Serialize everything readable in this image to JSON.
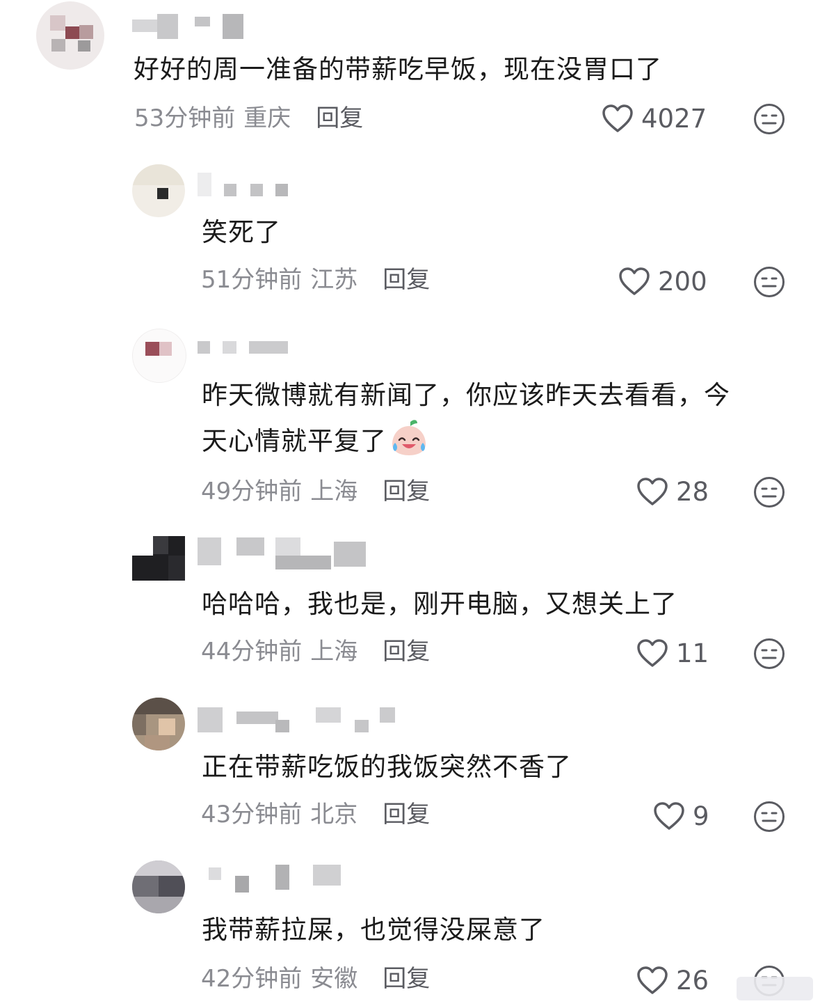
{
  "comments": [
    {
      "text": "好好的周一准备的带薪吃早饭，现在没胃口了",
      "time": "53分钟前",
      "location": "重庆",
      "reply": "回复",
      "likes": "4027"
    },
    {
      "text": "笑死了",
      "time": "51分钟前",
      "location": "江苏",
      "reply": "回复",
      "likes": "200"
    },
    {
      "text_line1": "昨天微博就有新闻了，你应该昨天去看看，今",
      "text_line2": "天心情就平复了",
      "emoji": "crying-laughing-emoji",
      "time": "49分钟前",
      "location": "上海",
      "reply": "回复",
      "likes": "28"
    },
    {
      "text": "哈哈哈，我也是，刚开电脑，又想关上了",
      "time": "44分钟前",
      "location": "上海",
      "reply": "回复",
      "likes": "11"
    },
    {
      "text": "正在带薪吃饭的我饭突然不香了",
      "time": "43分钟前",
      "location": "北京",
      "reply": "回复",
      "likes": "9"
    },
    {
      "text": "我带薪拉屎，也觉得没屎意了",
      "time": "42分钟前",
      "location": "安徽",
      "reply": "回复",
      "likes": "26"
    }
  ],
  "colors": {
    "text": "#1b1b1b",
    "meta": "#8a8b91",
    "icon": "#5a5b61"
  }
}
